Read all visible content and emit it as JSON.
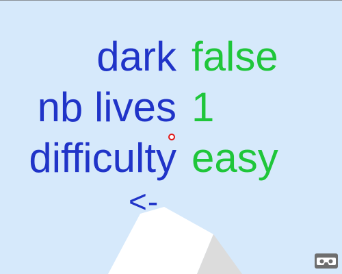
{
  "settings": {
    "dark": {
      "label": "dark",
      "value": "false"
    },
    "lives": {
      "label": "nb lives",
      "value": "1"
    },
    "difficulty": {
      "label": "difficulty",
      "value": "easy"
    }
  },
  "back_label": "<-",
  "colors": {
    "background": "#d6e9fb",
    "label": "#2034c8",
    "value": "#1fc63a",
    "cursor": "#e01818"
  },
  "icons": {
    "vr": "vr-goggles-icon"
  }
}
